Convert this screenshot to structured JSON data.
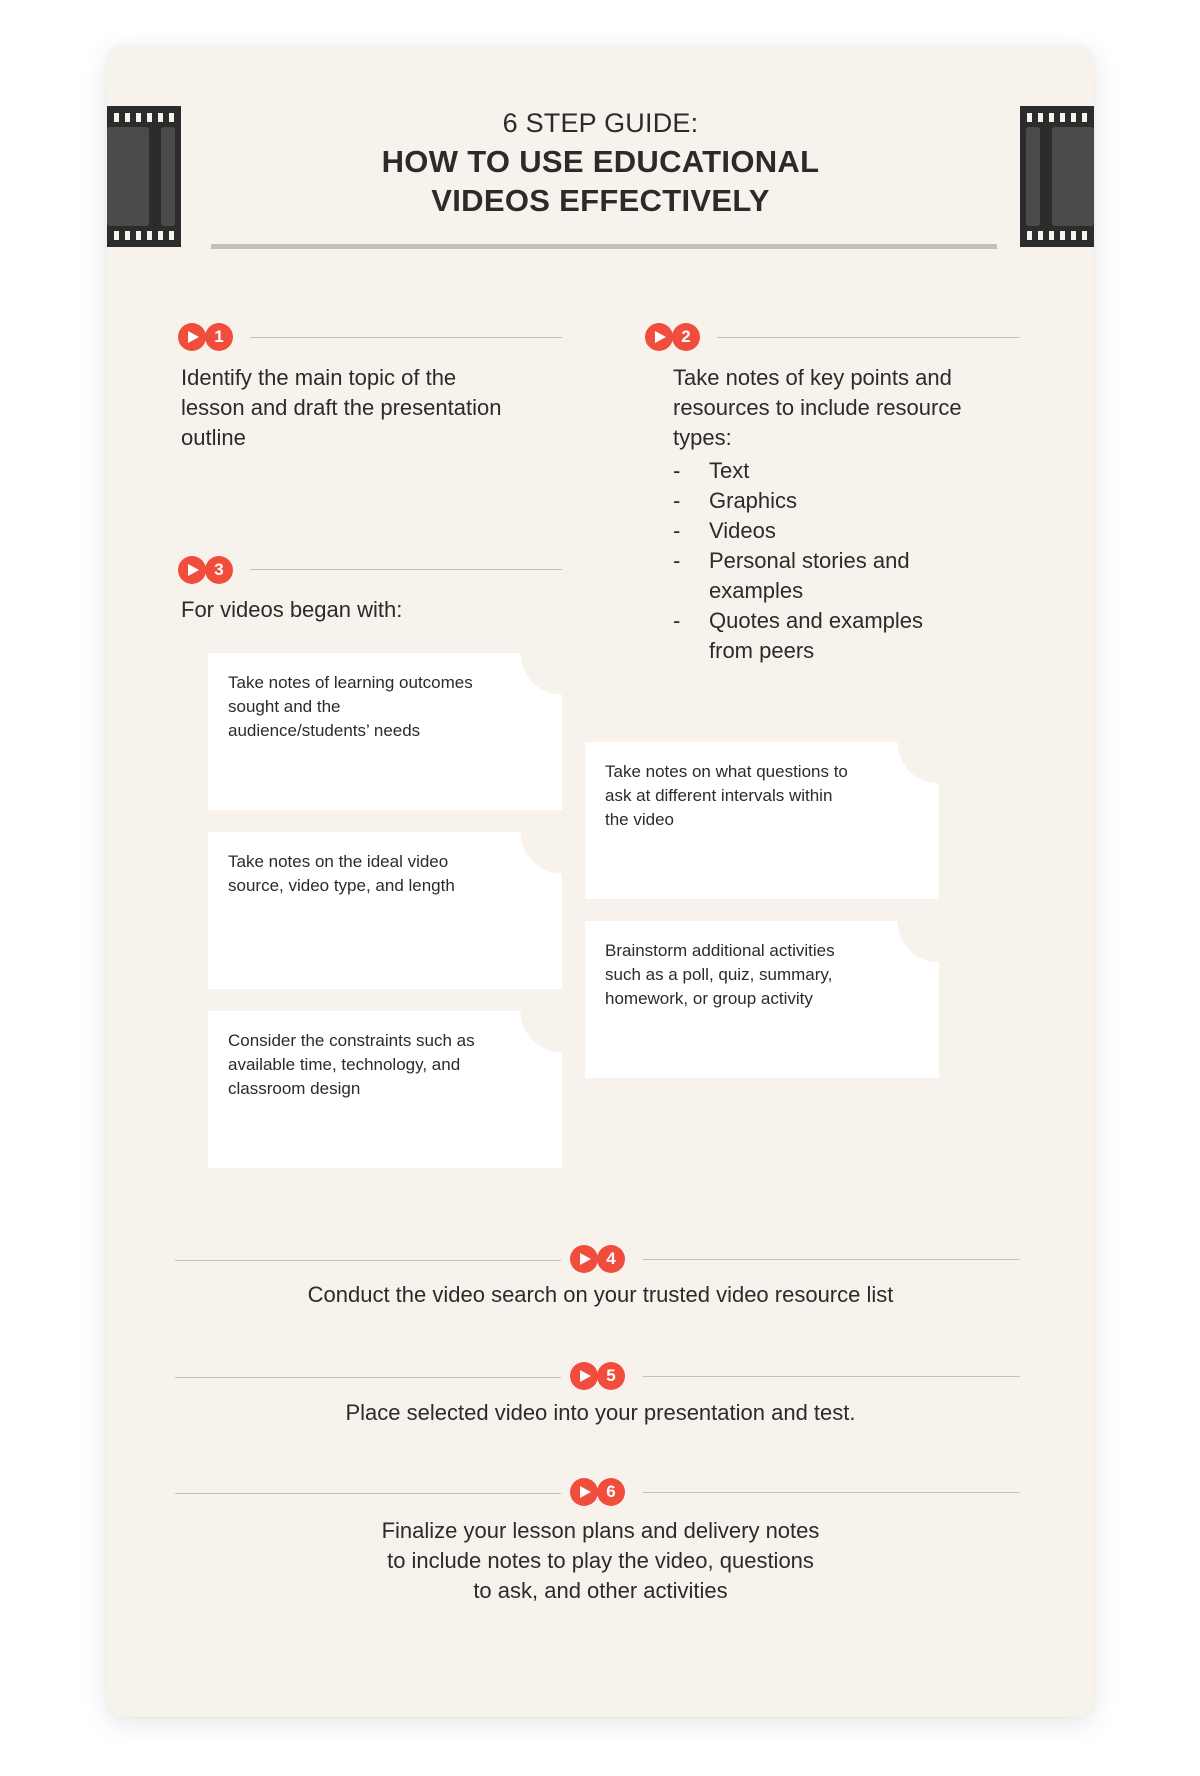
{
  "header": {
    "subtitle": "6 STEP GUIDE:",
    "title_line1": "HOW TO USE EDUCATIONAL",
    "title_line2": "VIDEOS EFFECTIVELY"
  },
  "colors": {
    "accent": "#f14d3d",
    "background": "#f7f2ec",
    "text": "#2b2b2b",
    "film": "#2c2c2c"
  },
  "steps": [
    {
      "number": "1",
      "icon": "play-icon",
      "text": "Identify the main topic of the lesson and draft the presentation outline"
    },
    {
      "number": "2",
      "icon": "play-icon",
      "text": "Take notes of key points and resources to include resource types:",
      "list": [
        {
          "bullet": "-",
          "text": "Text"
        },
        {
          "bullet": "-",
          "text": "Graphics"
        },
        {
          "bullet": "-",
          "text": "Videos"
        },
        {
          "bullet": "-",
          "text": "Personal stories and examples"
        },
        {
          "bullet": "-",
          "text": "Quotes and examples from peers"
        }
      ]
    },
    {
      "number": "3",
      "icon": "play-icon",
      "text": "For videos began with:",
      "notes": [
        "Take notes of learning outcomes sought and the audience/students’ needs",
        "Take notes on the ideal video source, video type, and length",
        "Consider the constraints such as available time, technology, and classroom design",
        "Take notes on what questions to ask at different intervals within the video",
        "Brainstorm additional activities such as a poll, quiz, summary, homework, or group activity"
      ]
    },
    {
      "number": "4",
      "icon": "play-icon",
      "text": "Conduct the video search on your trusted video resource list"
    },
    {
      "number": "5",
      "icon": "play-icon",
      "text": "Place selected video into your presentation and test."
    },
    {
      "number": "6",
      "icon": "play-icon",
      "text": "Finalize your lesson plans and delivery notes to include notes to play the video, questions to ask, and other activities"
    }
  ]
}
